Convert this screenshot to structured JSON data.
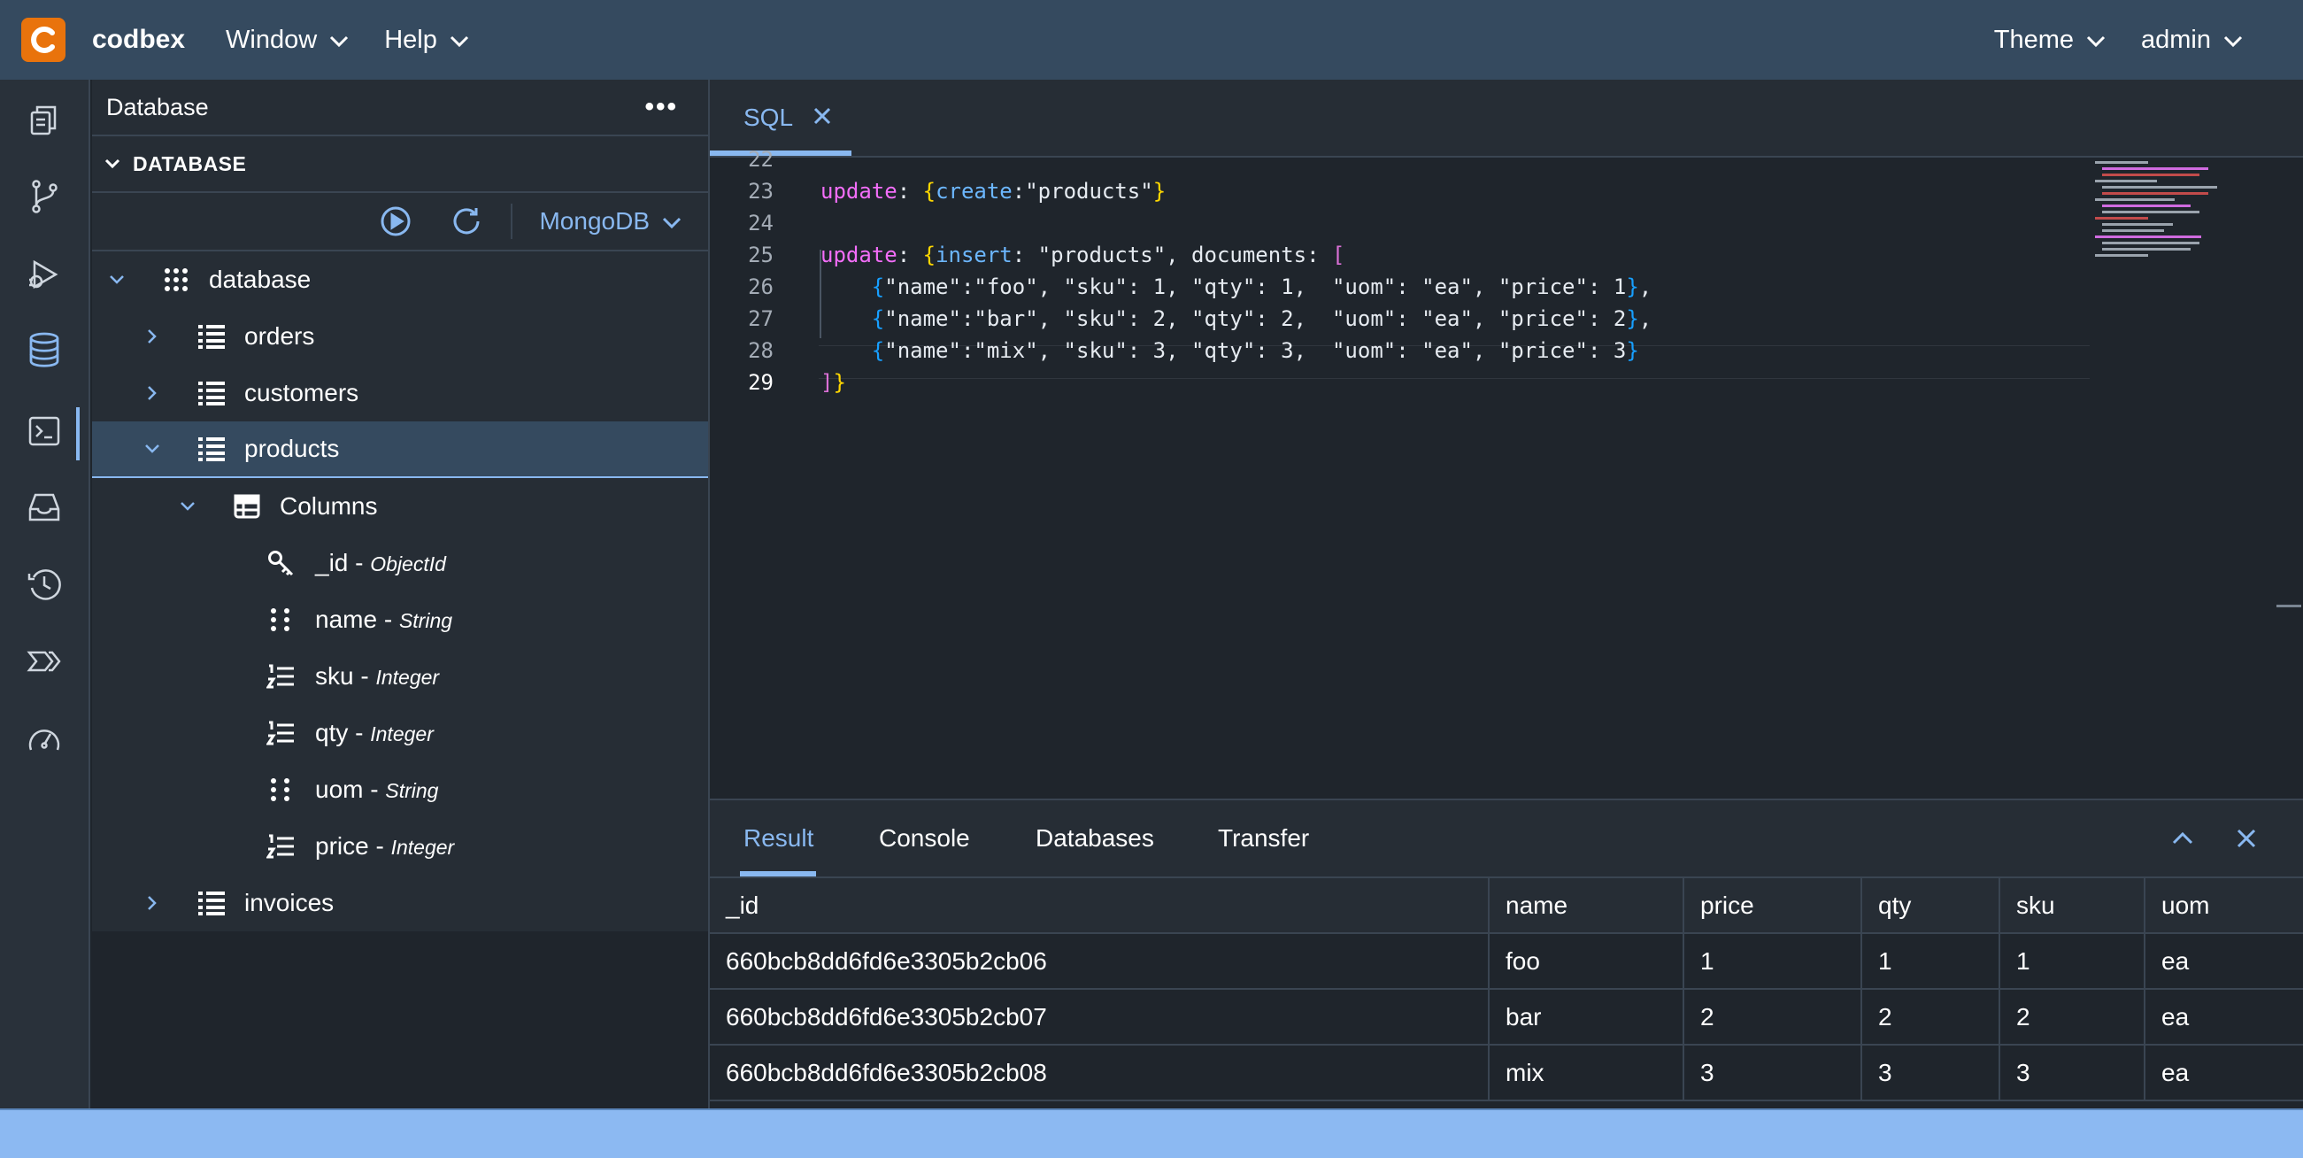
{
  "app": {
    "name": "codbex"
  },
  "topbar": {
    "menus": [
      "Window",
      "Help"
    ],
    "theme_label": "Theme",
    "user_label": "admin"
  },
  "activity_bar": {
    "icons": [
      "documents-icon",
      "git-branch-icon",
      "debug-run-icon",
      "database-icon",
      "terminal-icon",
      "inbox-icon",
      "history-icon",
      "pipeline-icon",
      "gauge-icon"
    ],
    "active": "database-icon"
  },
  "explorer": {
    "title": "Database",
    "section_title": "DATABASE",
    "db_type": "MongoDB",
    "tree": {
      "root": "database",
      "collections": [
        "orders",
        "customers",
        "products",
        "invoices"
      ],
      "expanded_collection": "products",
      "columns_label": "Columns",
      "columns": [
        {
          "name": "_id",
          "sep": " - ",
          "type": "ObjectId",
          "icon": "key-icon"
        },
        {
          "name": "name",
          "sep": " - ",
          "type": "String",
          "icon": "grid-dots-icon"
        },
        {
          "name": "sku",
          "sep": " - ",
          "type": "Integer",
          "icon": "numbered-list-icon"
        },
        {
          "name": "qty",
          "sep": " - ",
          "type": "Integer",
          "icon": "numbered-list-icon"
        },
        {
          "name": "uom",
          "sep": " - ",
          "type": "String",
          "icon": "grid-dots-icon"
        },
        {
          "name": "price",
          "sep": " - ",
          "type": "Integer",
          "icon": "numbered-list-icon"
        }
      ]
    }
  },
  "editor": {
    "tab_label": "SQL",
    "partial_line_number": "22",
    "lines": [
      {
        "n": "23",
        "tokens": [
          [
            "key",
            "update"
          ],
          [
            "plain",
            ": "
          ],
          [
            "y",
            "{"
          ],
          [
            "id",
            "create"
          ],
          [
            "plain",
            ":\"products\""
          ],
          [
            "y",
            "}"
          ]
        ]
      },
      {
        "n": "24",
        "tokens": []
      },
      {
        "n": "25",
        "tokens": [
          [
            "key",
            "update"
          ],
          [
            "plain",
            ": "
          ],
          [
            "y",
            "{"
          ],
          [
            "id",
            "insert"
          ],
          [
            "plain",
            ": \"products\", documents: "
          ],
          [
            "p",
            "["
          ]
        ]
      },
      {
        "n": "26",
        "tokens": [
          [
            "plain",
            "    "
          ],
          [
            "b",
            "{"
          ],
          [
            "plain",
            "\"name\":\"foo\", \"sku\": 1, \"qty\": 1,  \"uom\": \"ea\", \"price\": 1"
          ],
          [
            "b",
            "}"
          ],
          [
            "plain",
            ","
          ]
        ]
      },
      {
        "n": "27",
        "tokens": [
          [
            "plain",
            "    "
          ],
          [
            "b",
            "{"
          ],
          [
            "plain",
            "\"name\":\"bar\", \"sku\": 2, \"qty\": 2,  \"uom\": \"ea\", \"price\": 2"
          ],
          [
            "b",
            "}"
          ],
          [
            "plain",
            ","
          ]
        ]
      },
      {
        "n": "28",
        "tokens": [
          [
            "plain",
            "    "
          ],
          [
            "b",
            "{"
          ],
          [
            "plain",
            "\"name\":\"mix\", \"sku\": 3, \"qty\": 3,  \"uom\": \"ea\", \"price\": 3"
          ],
          [
            "b",
            "}"
          ]
        ]
      },
      {
        "n": "29",
        "tokens": [
          [
            "p",
            "]"
          ],
          [
            "y",
            "}"
          ]
        ]
      }
    ],
    "active_line": "29"
  },
  "panel": {
    "tabs": [
      "Result",
      "Console",
      "Databases",
      "Transfer"
    ],
    "active_tab": "Result",
    "result": {
      "columns": [
        "_id",
        "name",
        "price",
        "qty",
        "sku",
        "uom"
      ],
      "rows": [
        [
          "660bcb8dd6fd6e3305b2cb06",
          "foo",
          "1",
          "1",
          "1",
          "ea"
        ],
        [
          "660bcb8dd6fd6e3305b2cb07",
          "bar",
          "2",
          "2",
          "2",
          "ea"
        ],
        [
          "660bcb8dd6fd6e3305b2cb08",
          "mix",
          "3",
          "3",
          "3",
          "ea"
        ]
      ]
    }
  },
  "colors": {
    "accent": "#89b8f0",
    "topbar": "#354a5f",
    "brand_orange": "#e9730c",
    "statusbar": "#8cb9f2"
  }
}
